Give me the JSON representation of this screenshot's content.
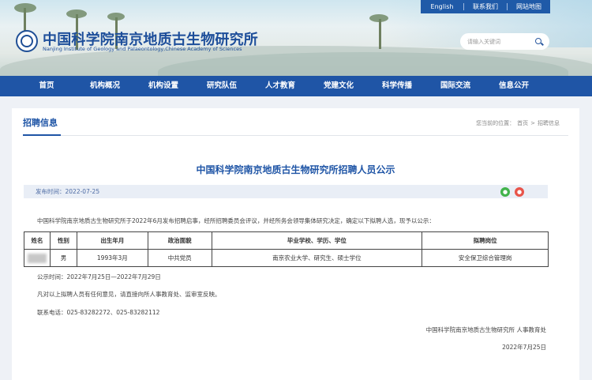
{
  "header": {
    "top_links": [
      "English",
      "联系我们",
      "网站地图"
    ],
    "title_cn": "中国科学院南京地质古生物研究所",
    "title_en": "Nanjing Institute of Geology and Palaeontology,Chinese Academy of Sciences",
    "search_placeholder": "请输入关键词"
  },
  "nav": {
    "items": [
      "首页",
      "机构概况",
      "机构设置",
      "研究队伍",
      "人才教育",
      "党建文化",
      "科学传播",
      "国际交流",
      "信息公开"
    ]
  },
  "section": {
    "title": "招聘信息",
    "breadcrumb_prefix": "您当前的位置：",
    "breadcrumb": [
      "首页",
      "招聘信息"
    ]
  },
  "article": {
    "title": "中国科学院南京地质古生物研究所招聘人员公示",
    "publish_label": "发布时间：2022-07-25",
    "intro": "中国科学院南京地质古生物研究所于2022年6月发布招聘启事，经所招聘委员会评议，并经所务会领导集体研究决定，确定以下拟聘人选，现予以公示：",
    "table": {
      "headers": [
        "姓名",
        "性别",
        "出生年月",
        "政治面貌",
        "毕业学校、学历、学位",
        "拟聘岗位"
      ],
      "rows": [
        [
          "",
          "男",
          "1993年3月",
          "中共党员",
          "南京农业大学、研究生、硕士学位",
          "安全保卫综合管理岗"
        ]
      ]
    },
    "period": "公示时间：2022年7月25日—2022年7月29日",
    "notice": "凡对以上拟聘人员有任何意见，请直接向所人事教育处、监审室反映。",
    "contact": "联系电话：025-83282272、025-83282112",
    "signature": "中国科学院南京地质古生物研究所 人事教育处",
    "sign_date": "2022年7月25日"
  }
}
